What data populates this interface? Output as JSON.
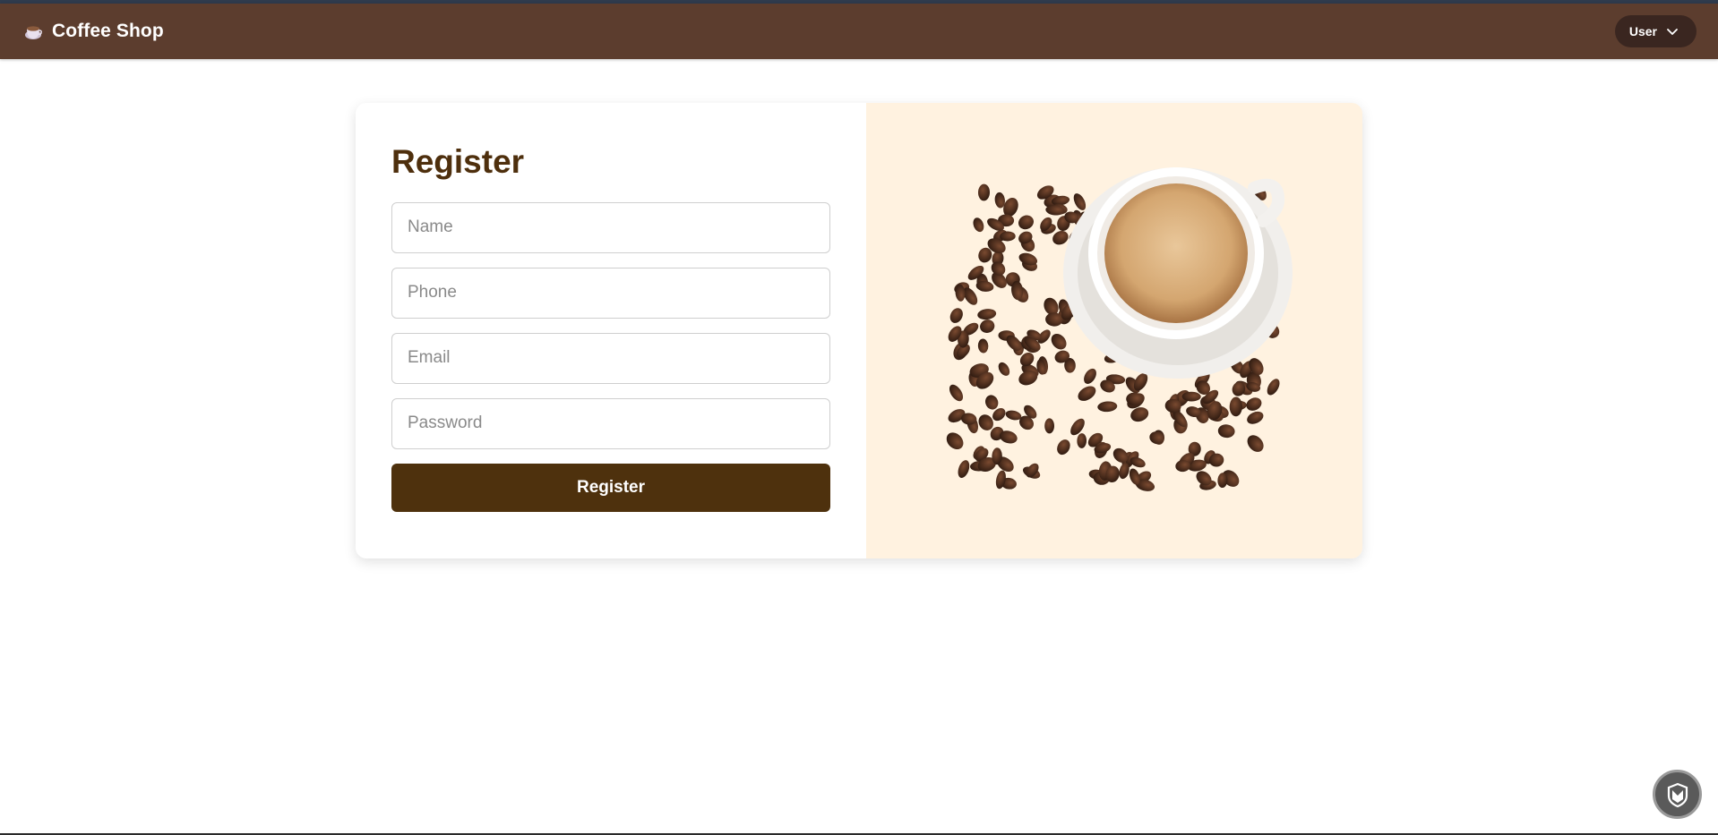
{
  "navbar": {
    "brand_icon": "coffee-cup-icon",
    "brand_label": "Coffee Shop",
    "user_menu_label": "User",
    "user_menu_icon": "chevron-down-icon"
  },
  "register_form": {
    "title": "Register",
    "fields": [
      {
        "name": "name",
        "placeholder": "Name",
        "value": ""
      },
      {
        "name": "phone",
        "placeholder": "Phone",
        "value": ""
      },
      {
        "name": "email",
        "placeholder": "Email",
        "value": ""
      },
      {
        "name": "password",
        "placeholder": "Password",
        "value": ""
      }
    ],
    "submit_label": "Register"
  },
  "hero_image": {
    "subject": "coffee-cup-with-beans-image"
  },
  "floating_button": {
    "icon": "shield-m-icon"
  },
  "colors": {
    "navbar_bg": "#5c3d2e",
    "title_color": "#4e2f0d",
    "button_bg": "#4e310d",
    "image_pane_bg": "#fff2e0"
  }
}
